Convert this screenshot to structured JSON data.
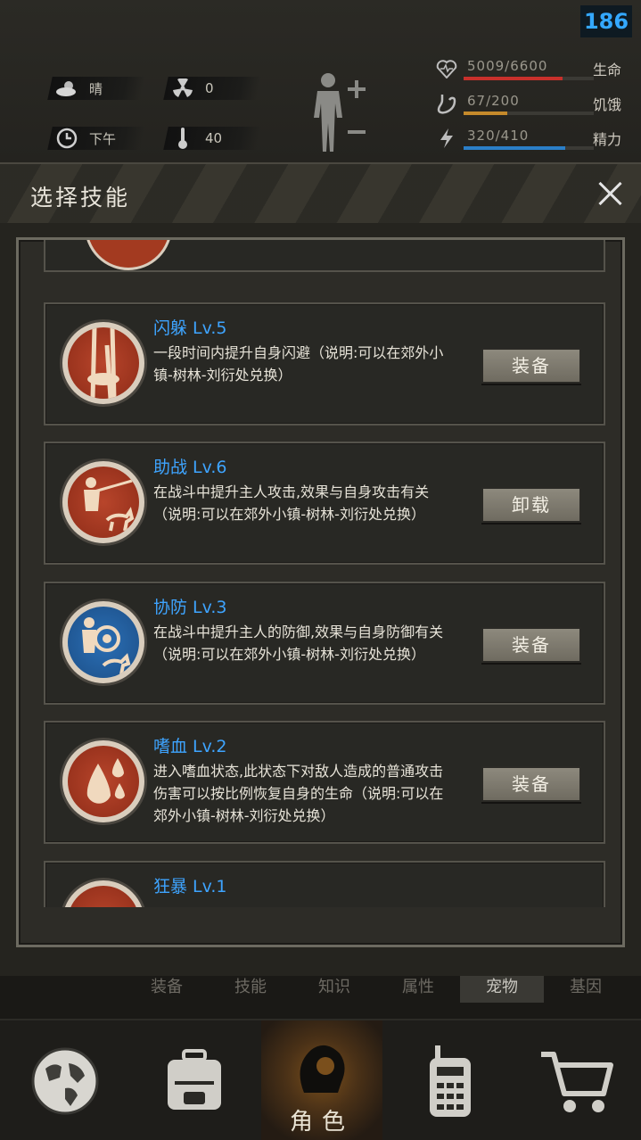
{
  "status": {
    "fps": "186",
    "weather": "晴",
    "radiation": "0",
    "time_of_day": "下午",
    "temperature": "40",
    "health": {
      "value": "5009/6600",
      "label": "生命",
      "ratio": 0.76,
      "color": "#c8302b"
    },
    "hunger": {
      "value": "67/200",
      "label": "饥饿",
      "ratio": 0.335,
      "color": "#c58a2b"
    },
    "energy": {
      "value": "320/410",
      "label": "精力",
      "ratio": 0.78,
      "color": "#2b7fc8"
    }
  },
  "modal": {
    "title": "选择技能",
    "skills": [
      {
        "name": "闪躲 Lv.5",
        "desc": "一段时间内提升自身闪避（说明:可以在郊外小镇-树林-刘衍处兑换）",
        "action": "装备",
        "icon": "dodge-icon"
      },
      {
        "name": "助战 Lv.6",
        "desc": "在战斗中提升主人攻击,效果与自身攻击有关（说明:可以在郊外小镇-树林-刘衍处兑换）",
        "action": "卸载",
        "icon": "assist-icon"
      },
      {
        "name": "协防 Lv.3",
        "desc": "在战斗中提升主人的防御,效果与自身防御有关（说明:可以在郊外小镇-树林-刘衍处兑换）",
        "action": "装备",
        "icon": "shield-icon"
      },
      {
        "name": "嗜血 Lv.2",
        "desc": "进入嗜血状态,此状态下对敌人造成的普通攻击伤害可以按比例恢复自身的生命（说明:可以在郊外小镇-树林-刘衍处兑换）",
        "action": "装备",
        "icon": "blood-drop-icon"
      },
      {
        "name": "狂暴 Lv.1",
        "desc": "",
        "action": "",
        "icon": "rage-icon"
      }
    ]
  },
  "tabs": [
    "装备",
    "技能",
    "知识",
    "属性",
    "宠物",
    "基因"
  ],
  "active_tab": "宠物",
  "nav": {
    "role_label": "角色"
  }
}
